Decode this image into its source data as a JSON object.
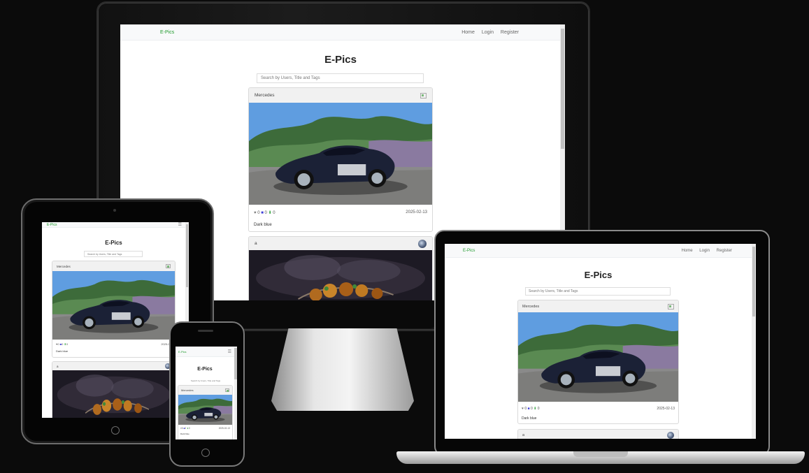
{
  "app": {
    "brand": "E-Pics",
    "title": "E-Pics",
    "nav_links": [
      "Home",
      "Login",
      "Register"
    ],
    "search_placeholder": "Search by Users, Title and Tags",
    "posts": [
      {
        "title": "Mercedes",
        "likes": "0",
        "comments": "0",
        "downloads": "0",
        "date": "2025-02-13",
        "caption": "Dark blue",
        "avatar_alt": "a"
      },
      {
        "title": "a"
      }
    ]
  },
  "tablet": {
    "date_partial": "2025-02",
    "phone_date": "2025-02-13",
    "phone_caption_partial": "Dark blue"
  },
  "colors": {
    "brand": "#1e9a2b",
    "comment_icon": "#3d3dd8",
    "download_icon": "#1e9a2b",
    "heart_icon": "#777777",
    "nav_bg": "#f8f9fa",
    "page_bg": "#0b0b0b"
  },
  "icons": {
    "heart": "heart-icon",
    "comment": "comment-icon",
    "download": "download-icon",
    "menu": "hamburger-icon"
  }
}
